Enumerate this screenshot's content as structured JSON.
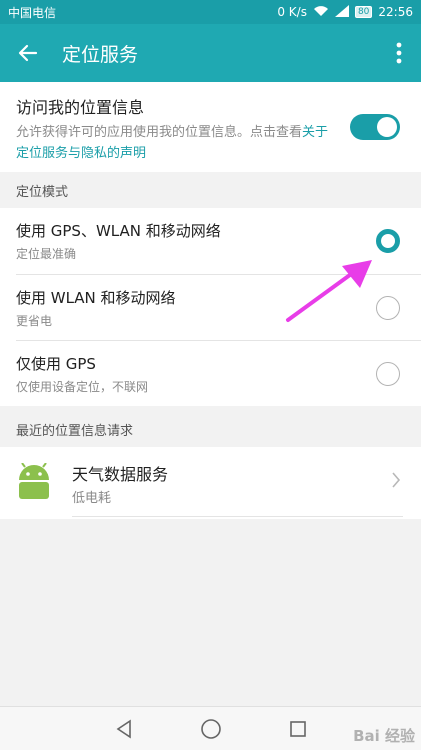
{
  "status_bar": {
    "carrier": "中国电信",
    "speed": "0 K/s",
    "battery": "80",
    "time": "22:56"
  },
  "app_bar": {
    "title": "定位服务"
  },
  "access": {
    "title": "访问我的位置信息",
    "desc_prefix": "允许获得许可的应用使用我的位置信息。点击查看",
    "desc_link": "关于定位服务与隐私的声明",
    "enabled": true
  },
  "mode_section": {
    "header": "定位模式",
    "options": [
      {
        "title": "使用 GPS、WLAN 和移动网络",
        "subtitle": "定位最准确",
        "selected": true
      },
      {
        "title": "使用 WLAN 和移动网络",
        "subtitle": "更省电",
        "selected": false
      },
      {
        "title": "仅使用 GPS",
        "subtitle": "仅使用设备定位，不联网",
        "selected": false
      }
    ]
  },
  "recent_section": {
    "header": "最近的位置信息请求",
    "items": [
      {
        "title": "天气数据服务",
        "subtitle": "低电耗",
        "icon": "android-icon"
      }
    ]
  },
  "watermark": "Bai 经验",
  "colors": {
    "accent": "#1a9ea8",
    "status_bar": "#1a9ea8",
    "app_bar": "#1fa9b2",
    "annotation_arrow": "#e83de8",
    "android_green": "#8cc04d"
  }
}
